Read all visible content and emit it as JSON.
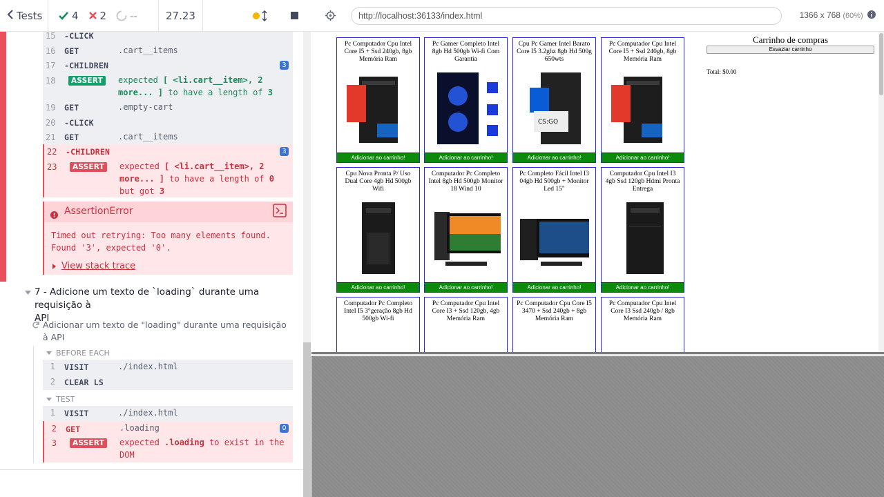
{
  "header": {
    "tests_label": "Tests",
    "passed": "4",
    "failed": "2",
    "pending": "--",
    "duration": "27.23"
  },
  "commands_top": [
    {
      "num": "15",
      "name": "-CLICK",
      "msg": ""
    },
    {
      "num": "16",
      "name": "GET",
      "msg": ".cart__items"
    },
    {
      "num": "17",
      "name": "-CHILDREN",
      "msg": "",
      "badge": "3"
    },
    {
      "num": "18",
      "name": "ASSERT",
      "msg_a": "expected",
      "msg_b": "[ <li.cart__item>, 2 more... ]",
      "msg_c": "to have a length of",
      "msg_d": "3"
    },
    {
      "num": "19",
      "name": "GET",
      "msg": ".empty-cart"
    },
    {
      "num": "20",
      "name": "-CLICK",
      "msg": ""
    },
    {
      "num": "21",
      "name": "GET",
      "msg": ".cart__items"
    },
    {
      "num": "22",
      "name": "-CHILDREN",
      "msg": "",
      "badge": "3"
    },
    {
      "num": "23",
      "name": "ASSERT",
      "msg_a": "expected",
      "msg_b": "[ <li.cart__item>, 2 more... ]",
      "msg_c": "to have a length of",
      "msg_d": "0",
      "msg_e": "but got",
      "msg_f": "3"
    }
  ],
  "error": {
    "title": "AssertionError",
    "message_line1": "Timed out retrying: Too many elements found.",
    "message_line2": "Found '3', expected '0'.",
    "stack": "View stack trace"
  },
  "test7": {
    "title_line1": "7 - Adicione um texto de `loading` durante uma requisição à",
    "title_line2": "API",
    "sub_line1": "Adicionar um texto de \"loading\" durante uma requisição",
    "sub_line2": "à API",
    "before_each": "BEFORE EACH",
    "test_label": "TEST",
    "before": [
      {
        "num": "1",
        "name": "VISIT",
        "msg": "./index.html"
      },
      {
        "num": "2",
        "name": "CLEAR LS",
        "msg": ""
      }
    ],
    "test": [
      {
        "num": "1",
        "name": "VISIT",
        "msg": "./index.html"
      },
      {
        "num": "2",
        "name": "GET",
        "msg": ".loading",
        "badge": "0"
      },
      {
        "num": "3",
        "name": "ASSERT",
        "msg_a": "expected",
        "msg_b": ".loading",
        "msg_c": "to exist in the DOM"
      }
    ]
  },
  "browser": {
    "url": "http://localhost:36133/index.html",
    "viewport": "1366 x 768",
    "scale": "(60%)"
  },
  "app": {
    "add_button": "Adicionar ao carrinho!",
    "products": [
      {
        "title": "Pc Computador Cpu Intel Core I5 + Ssd 240gb, 8gb Memória Ram"
      },
      {
        "title": "Pc Gamer Completo Intel 8gb Hd 500gb Wi-fi Com Garantia"
      },
      {
        "title": "Cpu Pc Gamer Intel Barato Core I5 3.2ghz 8gb Hd 500g 650wts"
      },
      {
        "title": "Pc Computador Cpu Intel Core I5 + Ssd 240gb, 8gb Memória Ram"
      },
      {
        "title": "Cpu Nova Pronta P/ Uso Dual Core 4gb Hd 500gb Wifi"
      },
      {
        "title": "Computador Pc Completo Intel 8gb Hd 500gb Monitor 18 Wind 10"
      },
      {
        "title": "Pc Completo Fácil Intel I3 04gb Hd 500gb + Monitor Led 15\""
      },
      {
        "title": "Computador Cpu Intel I3 4gb Ssd 120gb Hdmi Pronta Entrega"
      },
      {
        "title": "Computador Pc Completo Intel I5 3°geração 8gb Hd 500gb Wi-fi"
      },
      {
        "title": "Pc Computador Cpu Intel Core I3 + Ssd 120gb, 4gb Memória Ram"
      },
      {
        "title": "Pc Computador Cpu Core I5 3470 + Ssd 240gb + 8gb Memória Ram"
      },
      {
        "title": "Pc Computador Cpu Intel Core I3 Ssd 240gb / 8gb Memória Ram"
      }
    ],
    "cart_title": "Carrinho de compras",
    "empty_cart": "Esvaziar carrinho",
    "total": "Total: $0.00"
  },
  "colors": {
    "fail": "#e94f5c",
    "pass": "#1b8a5a",
    "badge": "#3c74d6",
    "button": "#0c8a0c"
  }
}
